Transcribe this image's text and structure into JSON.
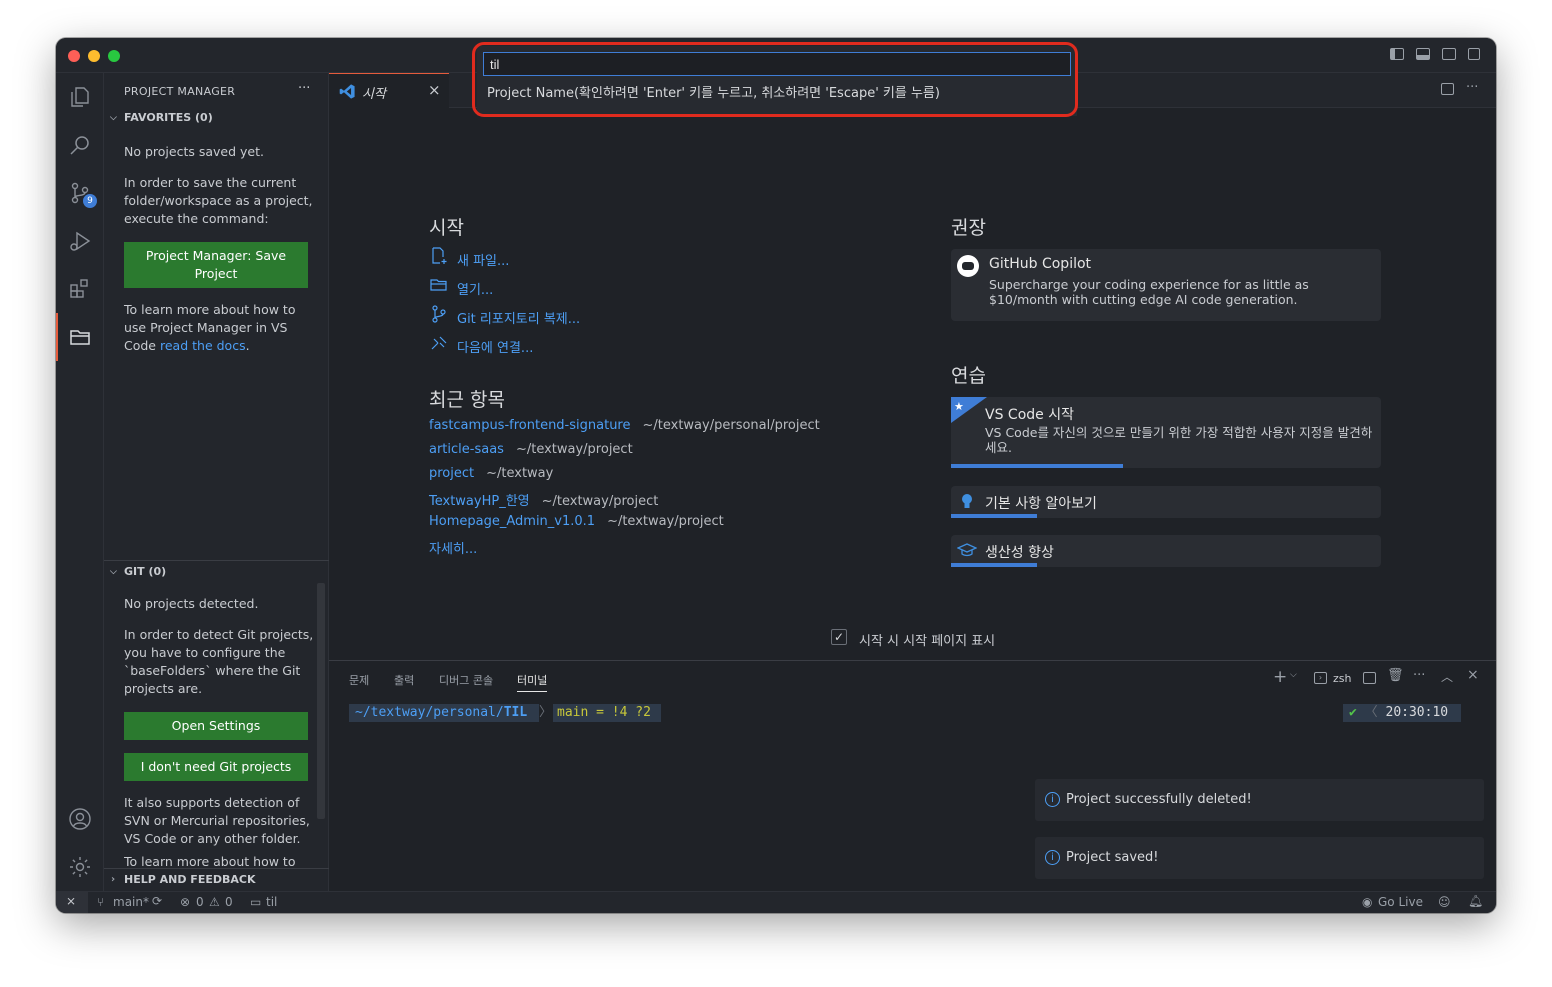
{
  "quick_input": {
    "value": "til",
    "prompt": "Project Name(확인하려면 'Enter' 키를 누르고, 취소하려면 'Escape' 키를 누름)"
  },
  "sidebar": {
    "title": "PROJECT MANAGER",
    "more": "···",
    "favorites_header": "FAVORITES (0)",
    "favorites_empty": "No projects saved yet.",
    "favorites_help": "In order to save the current folder/workspace as a project, execute the command:",
    "save_button": "Project Manager: Save Project",
    "learn_more_prefix": "To learn more about how to use Project Manager in VS Code",
    "learn_more_link": "read the docs",
    "learn_more_suffix": ".",
    "git_header": "GIT (0)",
    "git_empty": "No projects detected.",
    "git_help": "In order to detect Git projects, you have to configure the `baseFolders` where the Git projects are.",
    "open_settings_button": "Open Settings",
    "no_git_button": "I don't need Git projects",
    "also_supports": "It also supports detection of SVN or Mercurial repositories, VS Code or any other folder.",
    "cut_text": "To learn more about how to",
    "help_header": "HELP AND FEEDBACK",
    "scm_badge": "9"
  },
  "tab": {
    "label": "시작",
    "close": "×"
  },
  "welcome": {
    "start_heading": "시작",
    "start_items": [
      "새 파일...",
      "열기...",
      "Git 리포지토리 복제...",
      "다음에 연결..."
    ],
    "recent_heading": "최근 항목",
    "recent": [
      {
        "name": "fastcampus-frontend-signature",
        "path": "~/textway/personal/project"
      },
      {
        "name": "article-saas",
        "path": "~/textway/project"
      },
      {
        "name": "project",
        "path": "~/textway"
      },
      {
        "name": "TextwayHP_한영",
        "path": "~/textway/project"
      },
      {
        "name": "Homepage_Admin_v1.0.1",
        "path": "~/textway/project"
      }
    ],
    "more": "자세히...",
    "recommended_heading": "권장",
    "copilot_title": "GitHub Copilot",
    "copilot_desc": "Supercharge your coding experience for as little as $10/month with cutting edge AI code generation.",
    "practice_heading": "연습",
    "walkthrough1_title": "VS Code 시작",
    "walkthrough1_desc": "VS Code를 자신의 것으로 만들기 위한 가장 적합한 사용자 지정을 발견하세요.",
    "walkthrough1_progress": 0.4,
    "walkthrough2_title": "기본 사항 알아보기",
    "walkthrough2_progress": 0.2,
    "walkthrough3_title": "생산성 향상",
    "walkthrough3_progress": 0.2,
    "show_on_startup": "시작 시 시작 페이지 표시"
  },
  "panel": {
    "tabs": [
      "문제",
      "출력",
      "디버그 콘솔",
      "터미널"
    ],
    "active_tab": "터미널",
    "shell": "zsh",
    "prompt_path_prefix": "~/textway/personal/",
    "prompt_path_dir": "TIL",
    "prompt_branch": "main",
    "prompt_status": "= !4 ?2",
    "prompt_check": "✔",
    "prompt_time": "20:30:10"
  },
  "toasts": [
    "Project successfully deleted!",
    "Project saved!"
  ],
  "statusbar": {
    "branch": "main*",
    "errors": "0",
    "warnings": "0",
    "folder": "til",
    "go_live": "Go Live"
  }
}
